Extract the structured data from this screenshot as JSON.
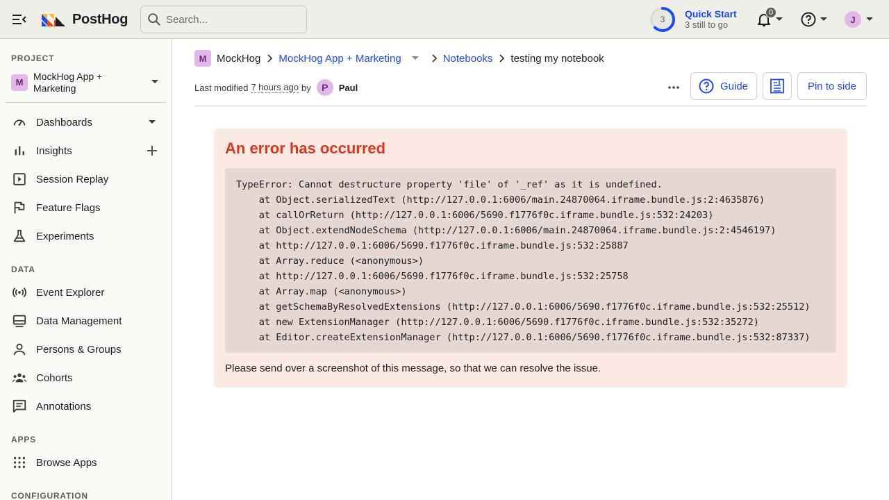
{
  "topbar": {
    "logo_text": "PostHog",
    "search_placeholder": "Search...",
    "quick_start": {
      "count": "3",
      "title": "Quick Start",
      "subtitle": "3 still to go",
      "progress": 0.62
    },
    "notifications_count": "0",
    "user_initial": "J"
  },
  "sidebar": {
    "project_heading": "PROJECT",
    "project": {
      "initial": "M",
      "name": "MockHog App + Marketing"
    },
    "items_project": [
      {
        "label": "Dashboards",
        "icon": "dashboard-icon"
      },
      {
        "label": "Insights",
        "icon": "bar-chart-icon"
      },
      {
        "label": "Session Replay",
        "icon": "play-box-icon"
      },
      {
        "label": "Feature Flags",
        "icon": "flag-icon"
      },
      {
        "label": "Experiments",
        "icon": "flask-icon"
      }
    ],
    "data_heading": "DATA",
    "items_data": [
      {
        "label": "Event Explorer",
        "icon": "broadcast-icon"
      },
      {
        "label": "Data Management",
        "icon": "database-icon"
      },
      {
        "label": "Persons & Groups",
        "icon": "person-icon"
      },
      {
        "label": "Cohorts",
        "icon": "users-icon"
      },
      {
        "label": "Annotations",
        "icon": "annotation-icon"
      }
    ],
    "apps_heading": "APPS",
    "items_apps": [
      {
        "label": "Browse Apps",
        "icon": "grid-dots-icon"
      }
    ],
    "config_heading": "CONFIGURATION"
  },
  "breadcrumb": {
    "org_initial": "M",
    "org": "MockHog",
    "project": "MockHog App + Marketing",
    "section": "Notebooks",
    "current": "testing my notebook"
  },
  "meta": {
    "prefix": "Last modified",
    "time": "7 hours ago",
    "by": "by",
    "user_initial": "P",
    "user": "Paul"
  },
  "actions": {
    "guide": "Guide",
    "pin": "Pin to side"
  },
  "error": {
    "title": "An error has occurred",
    "trace": "TypeError: Cannot destructure property 'file' of '_ref' as it is undefined.\n    at Object.serializedText (http://127.0.0.1:6006/main.24870064.iframe.bundle.js:2:4635876)\n    at callOrReturn (http://127.0.0.1:6006/5690.f1776f0c.iframe.bundle.js:532:24203)\n    at Object.extendNodeSchema (http://127.0.0.1:6006/main.24870064.iframe.bundle.js:2:4546197)\n    at http://127.0.0.1:6006/5690.f1776f0c.iframe.bundle.js:532:25887\n    at Array.reduce (<anonymous>)\n    at http://127.0.0.1:6006/5690.f1776f0c.iframe.bundle.js:532:25758\n    at Array.map (<anonymous>)\n    at getSchemaByResolvedExtensions (http://127.0.0.1:6006/5690.f1776f0c.iframe.bundle.js:532:25512)\n    at new ExtensionManager (http://127.0.0.1:6006/5690.f1776f0c.iframe.bundle.js:532:35272)\n    at Editor.createExtensionManager (http://127.0.0.1:6006/5690.f1776f0c.iframe.bundle.js:532:87337)",
    "note": "Please send over a screenshot of this message, so that we can resolve the issue."
  },
  "colors": {
    "accent": "#1d4aff",
    "error": "#d9381e",
    "error_bg": "#fbe9e3",
    "avatar": "#e2b8ea"
  }
}
